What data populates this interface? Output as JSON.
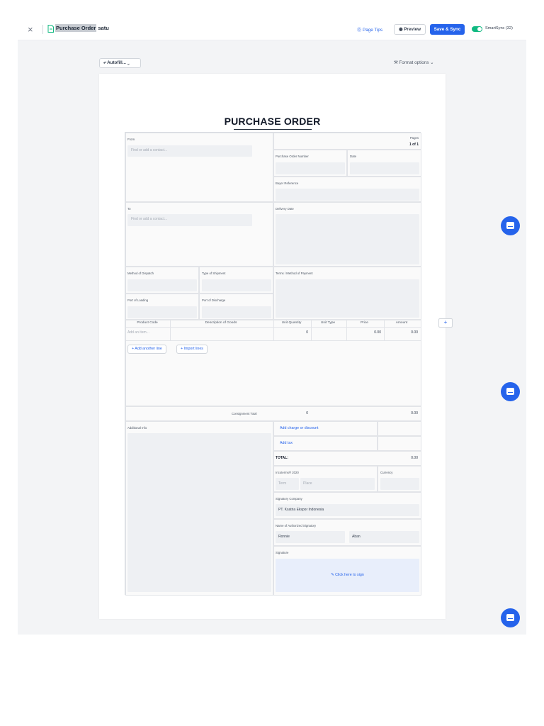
{
  "toolbar": {
    "close_icon": "×",
    "document_icon": "document-icon",
    "title_highlight": "Purchase Order",
    "title_rest": "satu",
    "page_tips": "Page Tips",
    "preview": "Preview",
    "save_sync": "Save & Sync",
    "smartsync_label": "SmartSync (32)",
    "smartsync_on": true
  },
  "subbar": {
    "autofill": "Autofill...",
    "format_options": "Format options"
  },
  "document": {
    "title": "PURCHASE ORDER",
    "from": {
      "label": "From",
      "placeholder": "Find or add a contact..."
    },
    "pages": {
      "label": "Pages",
      "value": "1 of 1"
    },
    "po_number": {
      "label": "Purchase Order Number",
      "value": ""
    },
    "date": {
      "label": "Date",
      "value": ""
    },
    "buyer_reference": {
      "label": "Buyer Reference",
      "value": ""
    },
    "to": {
      "label": "To",
      "placeholder": "Find or add a contact..."
    },
    "delivery_date": {
      "label": "Delivery Date",
      "value": ""
    },
    "method_of_dispatch": {
      "label": "Method of Dispatch",
      "value": ""
    },
    "type_of_shipment": {
      "label": "Type of Shipment",
      "value": ""
    },
    "terms_payment": {
      "label": "Terms / Method of Payment",
      "value": ""
    },
    "port_of_loading": {
      "label": "Port of Loading",
      "value": ""
    },
    "port_of_discharge": {
      "label": "Port of Discharge",
      "value": ""
    },
    "items_table": {
      "columns": [
        "Product Code",
        "Description of Goods",
        "Unit Quantity",
        "Unit Type",
        "Price",
        "Amount"
      ],
      "row_placeholder": "Add an item...",
      "row_quantity": "0",
      "row_price": "0.00",
      "row_amount": "0.00",
      "add_line": "Add another line",
      "import_lines": "Import lines"
    },
    "consignment": {
      "label": "Consignment Total",
      "quantity": "0",
      "amount": "0.00"
    },
    "additional_info": {
      "label": "Additional Info"
    },
    "charges": {
      "add_charge": "Add charge or discount",
      "add_tax": "Add tax",
      "total_label": "TOTAL:",
      "total_value": "0.00"
    },
    "incoterms": {
      "label": "Incoterms® 2020",
      "term_placeholder": "Term",
      "place_placeholder": "Place"
    },
    "currency": {
      "label": "Currency",
      "value": ""
    },
    "signatory_company": {
      "label": "Signatory Company",
      "value": "PT. Ksatria Ekspor Indonesia"
    },
    "authorized_signatory": {
      "label": "Name of Authorized Signatory",
      "first_name": "Ronnie",
      "last_name": "Aban"
    },
    "signature": {
      "label": "Signature",
      "cta": "Click here to sign"
    }
  },
  "colors": {
    "accent": "#2563eb",
    "toggle_on": "#10b981",
    "background": "#f3f4f6"
  }
}
